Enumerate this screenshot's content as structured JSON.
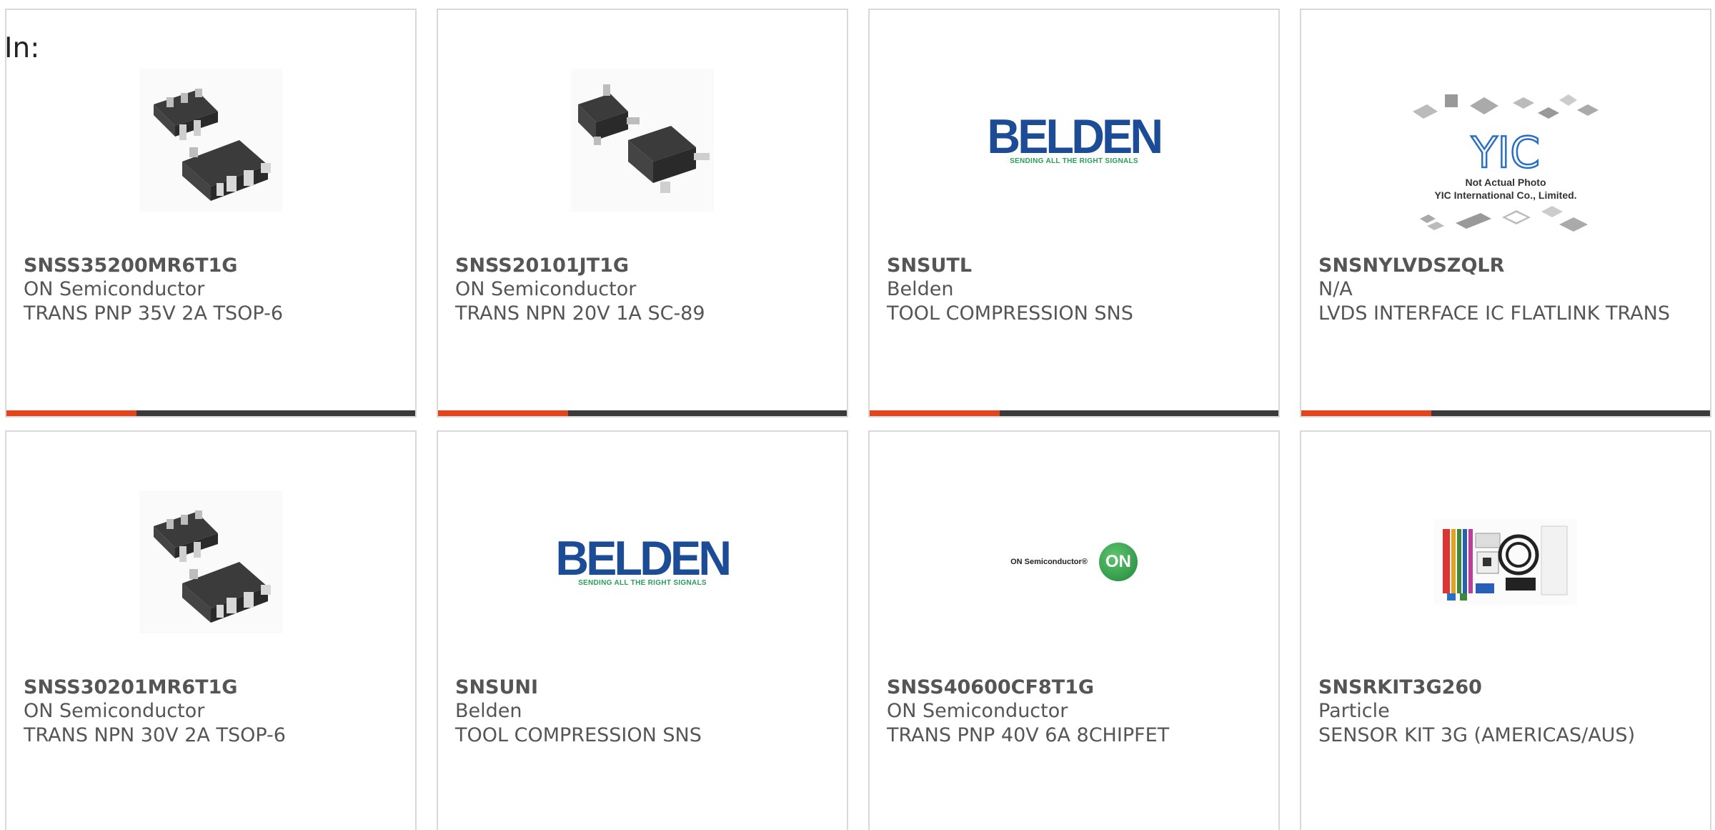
{
  "filter_label": "In:",
  "colors": {
    "accent": "#e2441d",
    "bar": "#3a3a3a",
    "belden_blue": "#1d4c97",
    "belden_green": "#26a05a",
    "on_green": "#2c9a45"
  },
  "products": [
    {
      "part_number": "SNSS35200MR6T1G",
      "manufacturer": "ON Semiconductor",
      "description": "TRANS PNP 35V 2A TSOP-6",
      "image": "tsop6-package"
    },
    {
      "part_number": "SNSS20101JT1G",
      "manufacturer": "ON Semiconductor",
      "description": "TRANS NPN 20V 1A SC-89",
      "image": "sc89-package"
    },
    {
      "part_number": "SNSUTL",
      "manufacturer": "Belden",
      "description": "TOOL COMPRESSION SNS",
      "image": "belden-logo"
    },
    {
      "part_number": "SNSNYLVDSZQLR",
      "manufacturer": "N/A",
      "description": "LVDS INTERFACE IC FLATLINK TRANS",
      "image": "yic-not-actual-photo"
    },
    {
      "part_number": "SNSS30201MR6T1G",
      "manufacturer": "ON Semiconductor",
      "description": "TRANS NPN 30V 2A TSOP-6",
      "image": "tsop6-package"
    },
    {
      "part_number": "SNSUNI",
      "manufacturer": "Belden",
      "description": "TOOL COMPRESSION SNS",
      "image": "belden-logo"
    },
    {
      "part_number": "SNSS40600CF8T1G",
      "manufacturer": "ON Semiconductor",
      "description": "TRANS PNP 40V 6A 8CHIPFET",
      "image": "on-semiconductor-logo"
    },
    {
      "part_number": "SNSRKIT3G260",
      "manufacturer": "Particle",
      "description": "SENSOR KIT 3G (AMERICAS/AUS)",
      "image": "sensor-kit-photo"
    }
  ],
  "logos": {
    "belden_word": "BELDEN",
    "belden_tagline": "SENDING ALL THE RIGHT SIGNALS",
    "on_text": "ON Semiconductor®",
    "on_mark": "ON",
    "yic_mark": "YIC",
    "yic_note_1": "Not Actual Photo",
    "yic_note_2": "YIC International Co., Limited."
  }
}
